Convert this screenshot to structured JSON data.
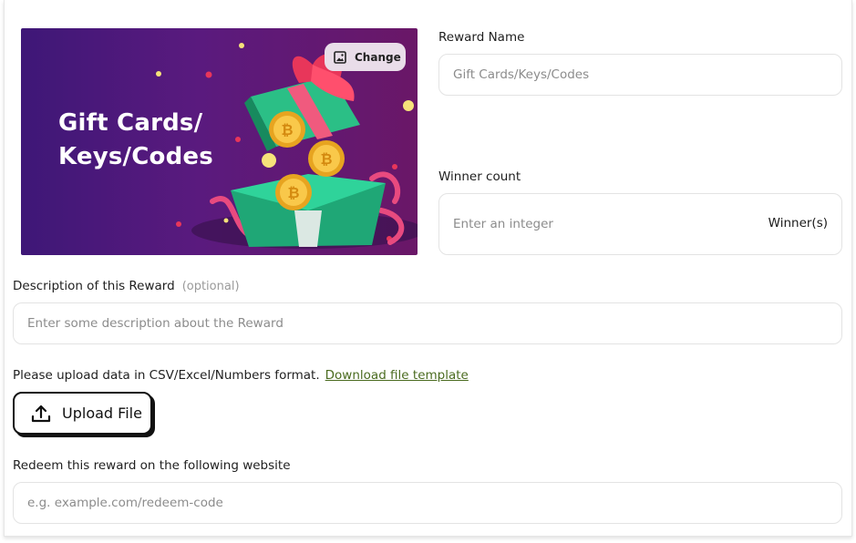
{
  "banner": {
    "title_line1": "Gift Cards/",
    "title_line2": "Keys/Codes",
    "change_label": "Change",
    "change_icon": "image-icon"
  },
  "reward_name": {
    "label": "Reward Name",
    "placeholder": "Gift Cards/Keys/Codes"
  },
  "winner_count": {
    "label": "Winner count",
    "placeholder": "Enter an integer",
    "suffix": "Winner(s)"
  },
  "description": {
    "label": "Description of this Reward",
    "optional": "(optional)",
    "placeholder": "Enter some description about the Reward"
  },
  "upload": {
    "note": "Please upload data in CSV/Excel/Numbers format.",
    "template_link": "Download file template",
    "button_label": "Upload File",
    "button_icon": "upload-icon"
  },
  "redeem": {
    "label": "Redeem this reward on the following website",
    "placeholder": "e.g. example.com/redeem-code"
  },
  "colors": {
    "banner_start": "#3e1777",
    "banner_end": "#6a1767",
    "link": "#4a6b1f"
  }
}
